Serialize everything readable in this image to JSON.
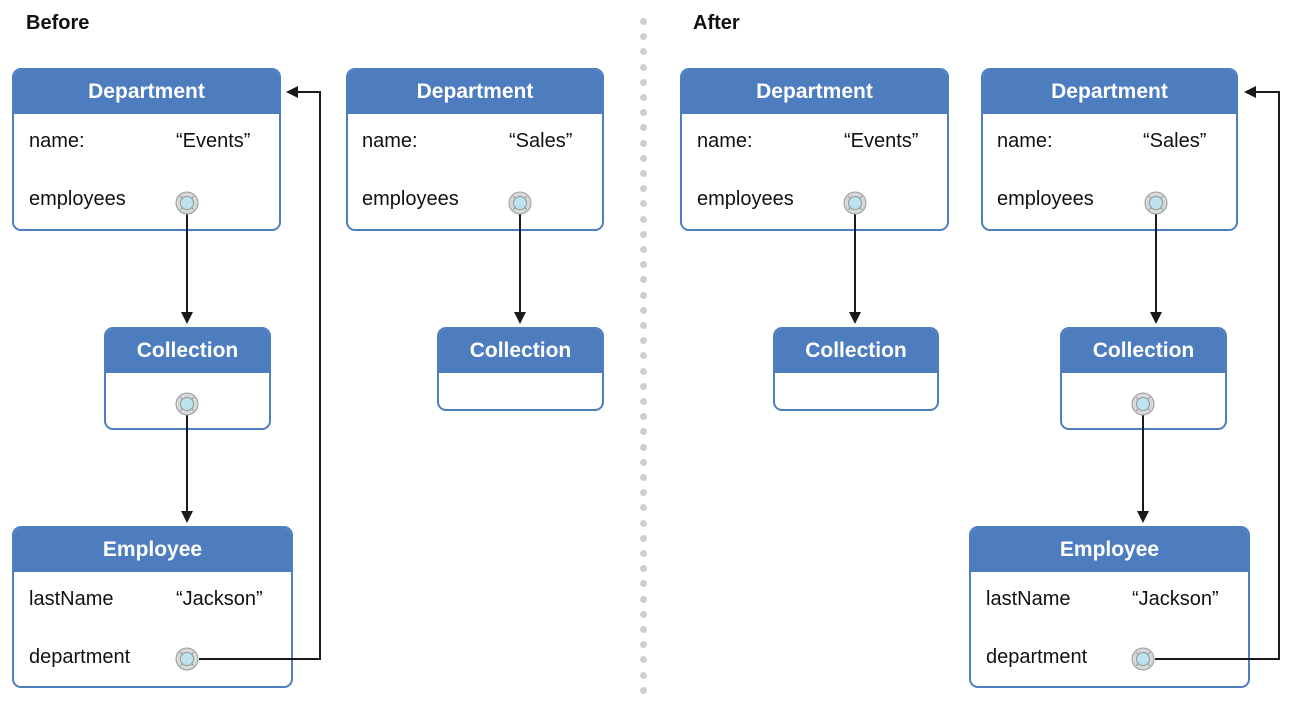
{
  "sections": {
    "before": {
      "title": "Before"
    },
    "after": {
      "title": "After"
    }
  },
  "entities": {
    "department_label": "Department",
    "collection_label": "Collection",
    "employee_label": "Employee"
  },
  "fields": {
    "name": "name:",
    "employees": "employees",
    "lastName": "lastName",
    "department": "department"
  },
  "values": {
    "events": "“Events”",
    "sales": "“Sales”",
    "jackson": "“Jackson”"
  },
  "colors": {
    "header_blue": "#4d7cbf",
    "knob_center": "#bfe3ee",
    "knob_ring": "#d8d8d8",
    "divider_dot": "#cfcfcf"
  }
}
